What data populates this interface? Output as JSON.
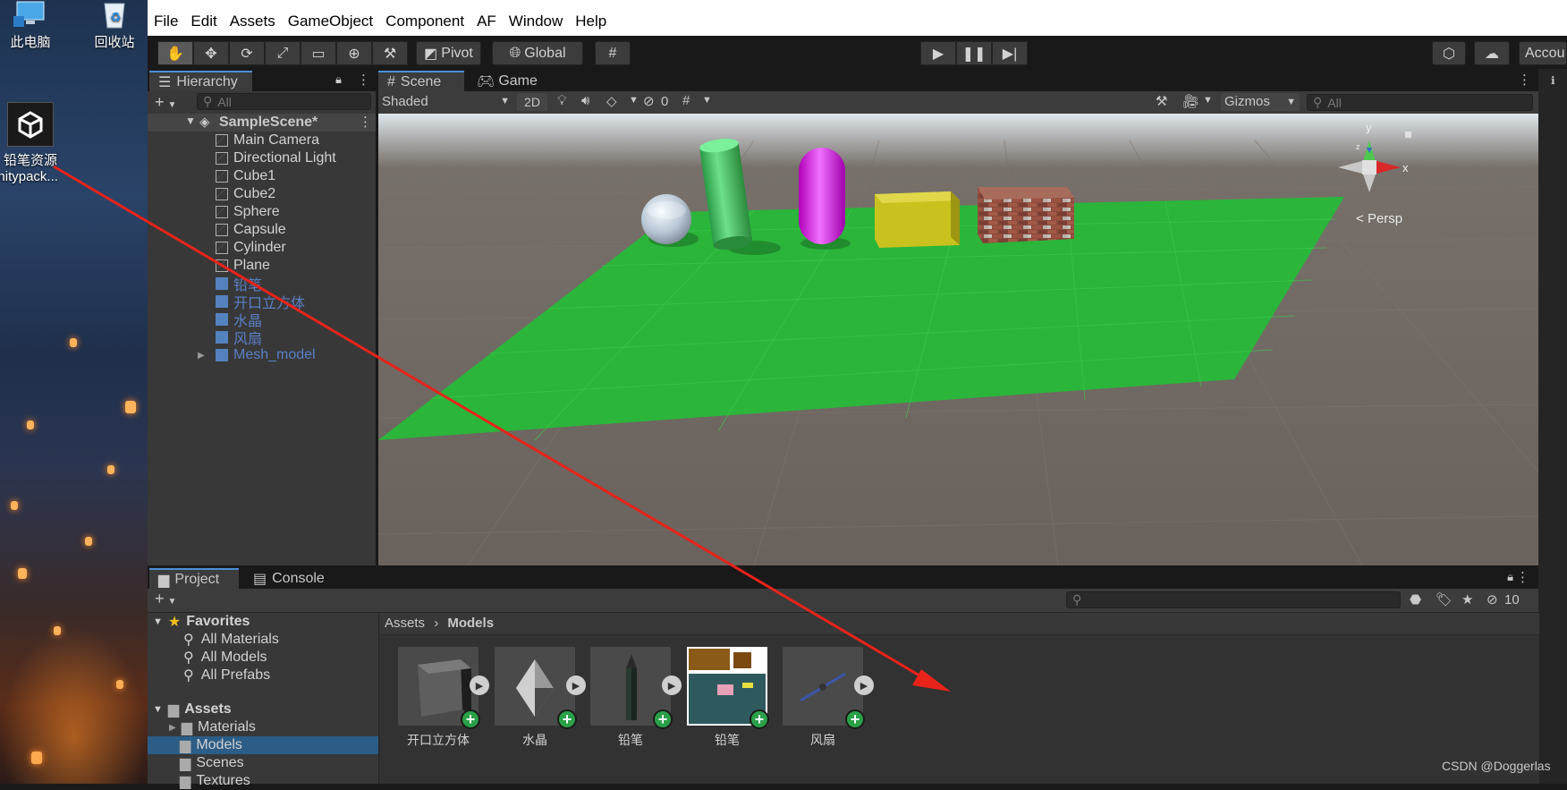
{
  "desktop": {
    "icons": [
      {
        "label": "此电脑"
      },
      {
        "label": "回收站"
      },
      {
        "label": "铅笔资源",
        "sublabel": "unitypack..."
      }
    ]
  },
  "menubar": {
    "items": [
      "File",
      "Edit",
      "Assets",
      "GameObject",
      "Component",
      "AF",
      "Window",
      "Help"
    ]
  },
  "toolbar": {
    "pivot_label": "Pivot",
    "global_label": "Global",
    "account_label": "Accou"
  },
  "hierarchy": {
    "tab_label": "Hierarchy",
    "search_placeholder": "All",
    "scene_name": "SampleScene*",
    "items": [
      {
        "label": "Main Camera",
        "prefab": false
      },
      {
        "label": "Directional Light",
        "prefab": false
      },
      {
        "label": "Cube1",
        "prefab": false
      },
      {
        "label": "Cube2",
        "prefab": false
      },
      {
        "label": "Sphere",
        "prefab": false
      },
      {
        "label": "Capsule",
        "prefab": false
      },
      {
        "label": "Cylinder",
        "prefab": false
      },
      {
        "label": "Plane",
        "prefab": false
      },
      {
        "label": "铅笔",
        "prefab": true
      },
      {
        "label": "开口立方体",
        "prefab": true
      },
      {
        "label": "水晶",
        "prefab": true
      },
      {
        "label": "风扇",
        "prefab": true
      },
      {
        "label": "Mesh_model",
        "prefab": true
      }
    ]
  },
  "scene": {
    "tabs": [
      "Scene",
      "Game"
    ],
    "shading_mode": "Shaded",
    "mode_2d": "2D",
    "hidden_count": "0",
    "gizmos_label": "Gizmos",
    "search_placeholder": "All",
    "persp_label": "Persp",
    "axis_y": "y",
    "axis_x": "x",
    "axis_z": "z"
  },
  "project": {
    "tabs": [
      "Project",
      "Console"
    ],
    "favorites_label": "Favorites",
    "favorites": [
      "All Materials",
      "All Models",
      "All Prefabs"
    ],
    "assets_label": "Assets",
    "asset_folders": [
      "Materials",
      "Models",
      "Scenes",
      "Textures"
    ],
    "selected_folder": "Models",
    "breadcrumb_root": "Assets",
    "breadcrumb_current": "Models",
    "hidden_count": "10",
    "assets": [
      {
        "label": "开口立方体",
        "kind": "cube"
      },
      {
        "label": "水晶",
        "kind": "crystal"
      },
      {
        "label": "铅笔",
        "kind": "pencil"
      },
      {
        "label": "铅笔",
        "kind": "texture"
      },
      {
        "label": "风扇",
        "kind": "fan"
      }
    ]
  },
  "watermark": "CSDN @Doggerlas",
  "colors": {
    "accent": "#4d8fd6",
    "selection": "#2c5d87",
    "plane_green": "#2bb53b",
    "annotation_arrow": "#e8231a",
    "prefab_text": "#5a7fc8"
  }
}
